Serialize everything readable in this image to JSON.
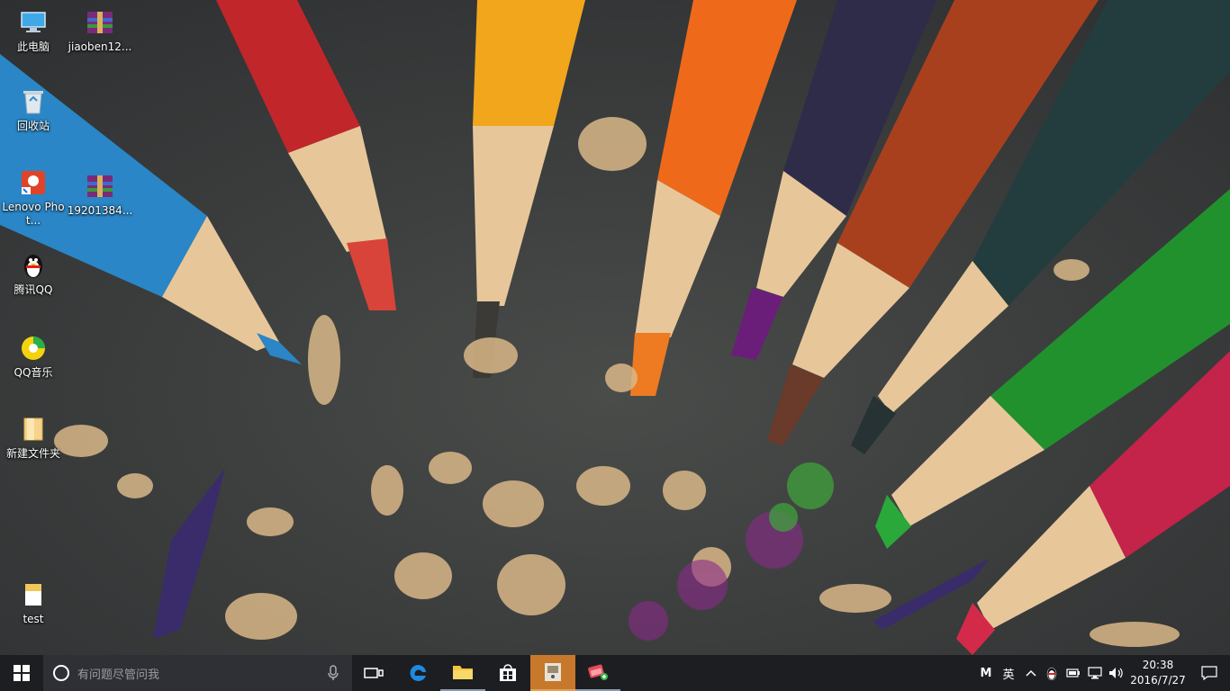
{
  "desktop": {
    "icons": [
      {
        "label": "此电脑",
        "icon": "computer-icon"
      },
      {
        "label": "jiaoben12...",
        "icon": "winrar-archive-icon"
      },
      {
        "label": "回收站",
        "icon": "recycle-bin-icon"
      },
      {
        "label": "Lenovo Phot...",
        "icon": "lenovo-photo-icon"
      },
      {
        "label": "19201384...",
        "icon": "winrar-archive-icon"
      },
      {
        "label": "腾讯QQ",
        "icon": "qq-penguin-icon"
      },
      {
        "label": "QQ音乐",
        "icon": "qq-music-icon"
      },
      {
        "label": "新建文件夹",
        "icon": "folder-icon"
      },
      {
        "label": "test",
        "icon": "text-file-icon"
      }
    ]
  },
  "taskbar": {
    "search_placeholder": "有问题尽管问我",
    "pinned": [
      "task-view-icon",
      "edge-icon",
      "file-explorer-icon",
      "store-icon",
      "image-app-icon",
      "paint-app-icon"
    ],
    "tray": {
      "ime_mode": "M",
      "ime_lang": "英",
      "time": "20:38",
      "date": "2016/7/27"
    },
    "accent": "#c8782a"
  }
}
